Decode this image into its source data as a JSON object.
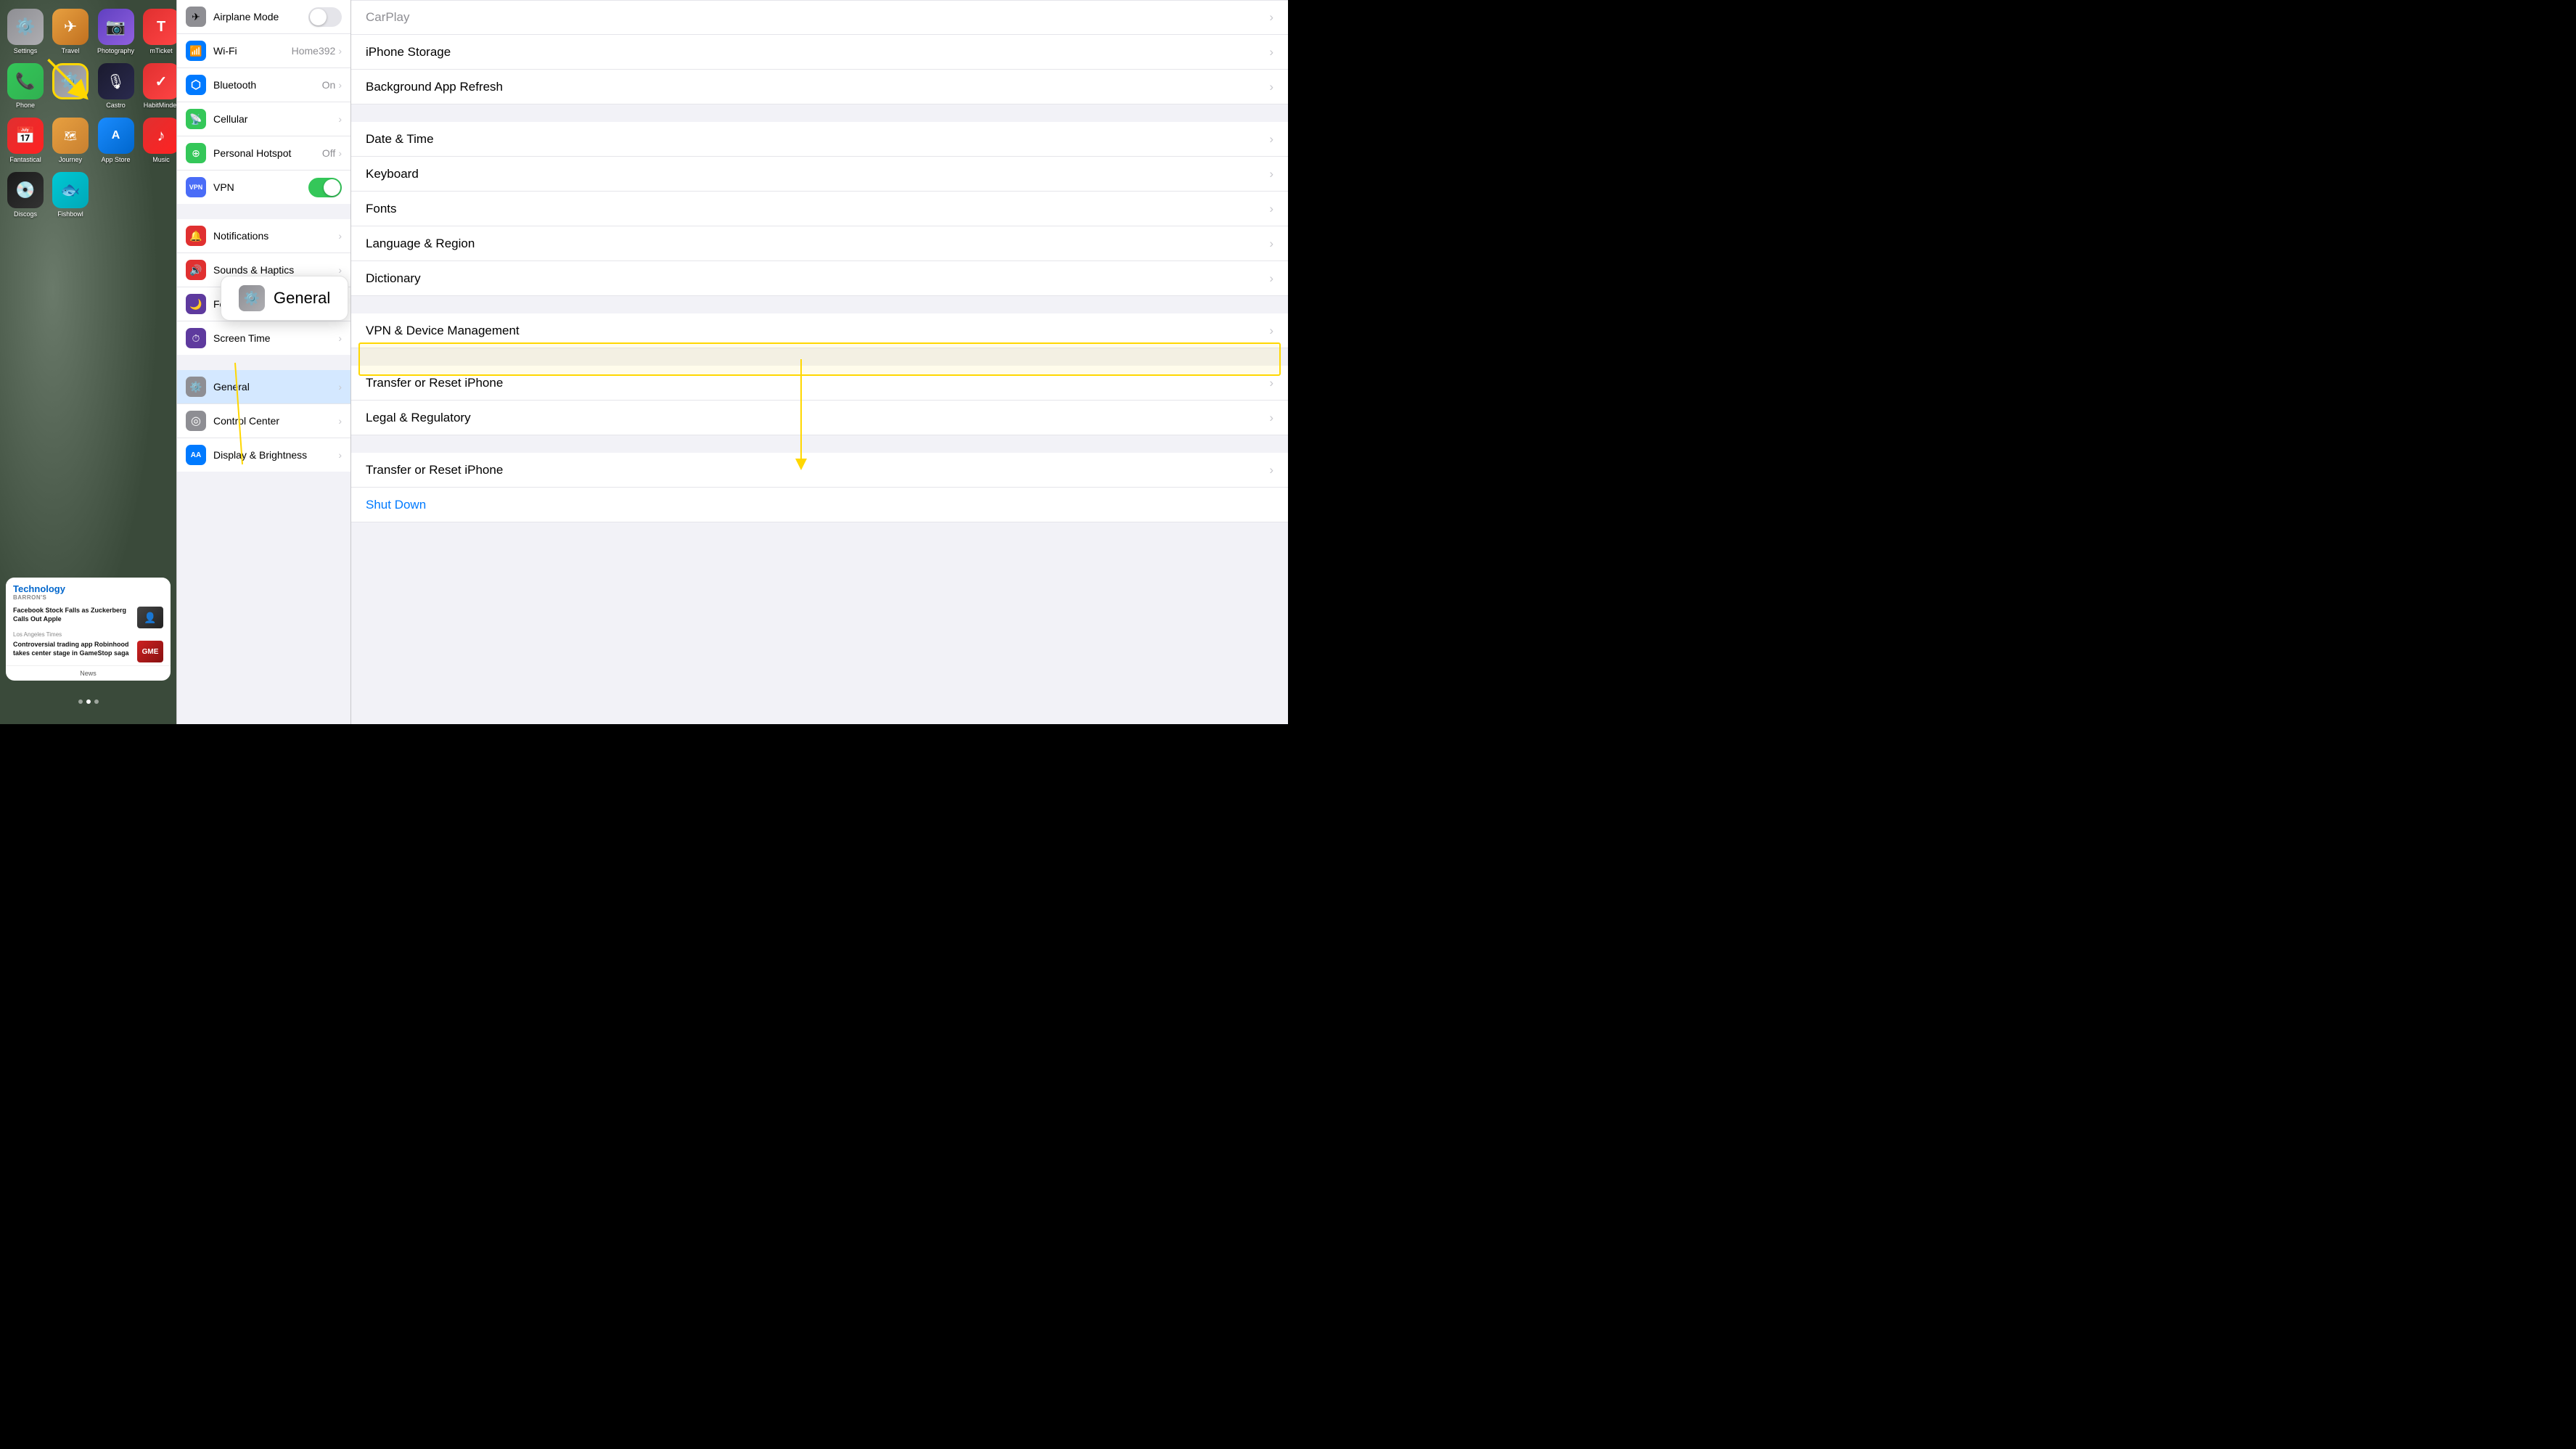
{
  "leftPanel": {
    "apps": [
      {
        "id": "settings",
        "label": "Settings",
        "icon": "⚙️",
        "iconClass": "icon-settings"
      },
      {
        "id": "travel",
        "label": "Travel",
        "icon": "✈",
        "iconClass": "icon-travel"
      },
      {
        "id": "photography",
        "label": "Photography",
        "icon": "📷",
        "iconClass": "icon-photography"
      },
      {
        "id": "mticket",
        "label": "mTicket",
        "icon": "T",
        "iconClass": "icon-mticket"
      },
      {
        "id": "phone",
        "label": "Phone",
        "icon": "📞",
        "iconClass": "icon-phone"
      },
      {
        "id": "settings2",
        "label": "",
        "icon": "⚙️",
        "iconClass": "icon-settings2"
      },
      {
        "id": "castro",
        "label": "Castro",
        "icon": "🎙",
        "iconClass": "icon-castro"
      },
      {
        "id": "habitminder",
        "label": "HabitMinder",
        "icon": "✓",
        "iconClass": "icon-habitminder"
      },
      {
        "id": "fantastical",
        "label": "Fantastical",
        "icon": "📅",
        "iconClass": "icon-fantastical"
      },
      {
        "id": "journey",
        "label": "Journey",
        "icon": "✈",
        "iconClass": "icon-journey"
      },
      {
        "id": "appstore",
        "label": "App Store",
        "icon": "A",
        "iconClass": "icon-appstore"
      },
      {
        "id": "music",
        "label": "Music",
        "icon": "♪",
        "iconClass": "icon-music"
      },
      {
        "id": "discogs",
        "label": "Discogs",
        "icon": "💿",
        "iconClass": "icon-discogs"
      },
      {
        "id": "fishbowl",
        "label": "Fishbowl",
        "icon": "🐟",
        "iconClass": "icon-fishbowl"
      }
    ],
    "newsWidget": {
      "category": "Technology",
      "articles": [
        {
          "source": "BARRON'S",
          "headline": "Facebook Stock Falls as Zuckerberg Calls Out Apple"
        },
        {
          "source": "Los Angeles Times",
          "headline": "Controversial trading app Robinhood takes center stage in GameStop saga"
        }
      ],
      "footer": "News"
    },
    "pageDots": [
      0,
      1,
      2
    ],
    "activeDot": 1
  },
  "middlePanel": {
    "sections": [
      {
        "rows": [
          {
            "id": "airplane",
            "label": "Airplane Mode",
            "iconClass": "icon-airplane",
            "iconText": "✈",
            "toggleState": "off",
            "hasToggle": true
          },
          {
            "id": "wifi",
            "label": "Wi-Fi",
            "iconClass": "icon-wifi",
            "iconText": "📶",
            "value": "Home392",
            "hasChevron": true
          },
          {
            "id": "bluetooth",
            "label": "Bluetooth",
            "iconClass": "icon-bluetooth",
            "iconText": "⬡",
            "value": "On",
            "hasChevron": true
          },
          {
            "id": "cellular",
            "label": "Cellular",
            "iconClass": "icon-cellular",
            "iconText": "📡",
            "hasChevron": true
          },
          {
            "id": "hotspot",
            "label": "Personal Hotspot",
            "iconClass": "icon-hotspot",
            "iconText": "⊕",
            "value": "Off",
            "hasChevron": true
          },
          {
            "id": "vpn",
            "label": "VPN",
            "iconClass": "icon-vpn",
            "iconText": "VPN",
            "toggleState": "on",
            "hasToggle": true
          }
        ]
      },
      {
        "rows": [
          {
            "id": "notifications",
            "label": "Notifications",
            "iconClass": "icon-notif",
            "iconText": "🔔",
            "hasChevron": true
          },
          {
            "id": "sounds",
            "label": "Sounds & Haptics",
            "iconClass": "icon-sounds",
            "iconText": "🔊",
            "hasChevron": true
          },
          {
            "id": "focus",
            "label": "Focus",
            "iconClass": "icon-focus",
            "iconText": "🌙",
            "hasChevron": true
          },
          {
            "id": "screentime",
            "label": "Screen Time",
            "iconClass": "icon-screentime",
            "iconText": "⏱",
            "hasChevron": true
          }
        ]
      },
      {
        "rows": [
          {
            "id": "general",
            "label": "General",
            "iconClass": "icon-general",
            "iconText": "⚙️",
            "hasChevron": true
          },
          {
            "id": "controlcenter",
            "label": "Control Center",
            "iconClass": "icon-control",
            "iconText": "◎",
            "hasChevron": true
          },
          {
            "id": "display",
            "label": "Display & Brightness",
            "iconClass": "icon-display",
            "iconText": "AA",
            "hasChevron": true
          }
        ]
      }
    ],
    "generalPopup": {
      "icon": "⚙️",
      "label": "General"
    }
  },
  "rightPanel": {
    "rows": [
      {
        "id": "carplay",
        "label": "CarPlay",
        "hasChevron": true,
        "isPartial": true
      },
      {
        "id": "iphone-storage",
        "label": "iPhone Storage",
        "hasChevron": true
      },
      {
        "id": "background-refresh",
        "label": "Background App Refresh",
        "hasChevron": true
      },
      {
        "id": "date-time",
        "label": "Date & Time",
        "hasChevron": true
      },
      {
        "id": "keyboard",
        "label": "Keyboard",
        "hasChevron": true
      },
      {
        "id": "fonts",
        "label": "Fonts",
        "hasChevron": true
      },
      {
        "id": "language-region",
        "label": "Language & Region",
        "hasChevron": true
      },
      {
        "id": "dictionary",
        "label": "Dictionary",
        "hasChevron": true
      },
      {
        "id": "vpn-device",
        "label": "VPN & Device Management",
        "hasChevron": true
      },
      {
        "id": "transfer-reset",
        "label": "Transfer or Reset iPhone",
        "hasChevron": true
      },
      {
        "id": "legal",
        "label": "Legal & Regulatory",
        "hasChevron": true
      },
      {
        "id": "transfer-reset2",
        "label": "Transfer or Reset iPhone",
        "hasChevron": true
      },
      {
        "id": "shutdown",
        "label": "Shut Down",
        "hasChevron": false,
        "isBlue": true
      }
    ],
    "highlightLabel": "Transfer or Reset iPhone",
    "sectionBreaks": [
      2,
      7,
      9,
      11
    ]
  }
}
